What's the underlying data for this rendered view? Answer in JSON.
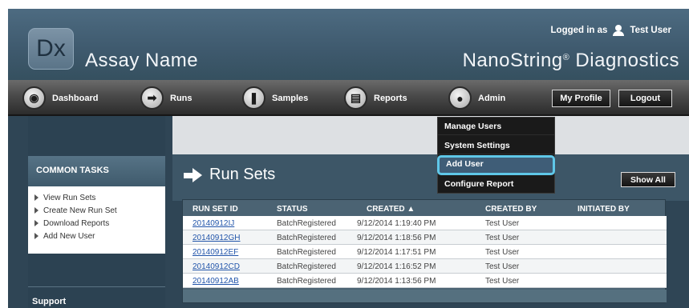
{
  "header": {
    "logo_text": "Dx",
    "app_title": "Assay Name",
    "brand_name": "NanoString",
    "brand_mark": "®",
    "brand_suffix": " Diagnostics",
    "logged_in_prefix": "Logged in as",
    "user_name": "Test User",
    "user_icon": "person-icon"
  },
  "nav": {
    "items": [
      {
        "label": "Dashboard",
        "icon": "dashboard-icon",
        "glyph": "◉"
      },
      {
        "label": "Runs",
        "icon": "runs-arrow-icon",
        "glyph": "➡"
      },
      {
        "label": "Samples",
        "icon": "samples-tube-icon",
        "glyph": "❚"
      },
      {
        "label": "Reports",
        "icon": "reports-icon",
        "glyph": "▤"
      },
      {
        "label": "Admin",
        "icon": "admin-person-icon",
        "glyph": "●"
      }
    ],
    "my_profile": "My Profile",
    "logout": "Logout"
  },
  "admin_menu": {
    "items": [
      "Manage Users",
      "System Settings",
      "Add User",
      "Configure Report"
    ],
    "highlighted": "Add User",
    "highlight_color": "#5fc7e8"
  },
  "sidebar": {
    "common_tasks_title": "COMMON TASKS",
    "tasks": [
      "View Run Sets",
      "Create New Run Set",
      "Download Reports",
      "Add New User"
    ],
    "support_title": "Support"
  },
  "run_sets": {
    "title": "Run Sets",
    "show_all": "Show All",
    "columns": [
      "RUN SET ID",
      "STATUS",
      "CREATED ▲",
      "CREATED BY",
      "INITIATED BY"
    ],
    "rows": [
      {
        "id": "20140912IJ",
        "status": "BatchRegistered",
        "created": "9/12/2014 1:19:40 PM",
        "created_by": "Test User",
        "initiated_by": ""
      },
      {
        "id": "20140912GH",
        "status": "BatchRegistered",
        "created": "9/12/2014 1:18:56 PM",
        "created_by": "Test User",
        "initiated_by": ""
      },
      {
        "id": "20140912EF",
        "status": "BatchRegistered",
        "created": "9/12/2014 1:17:51 PM",
        "created_by": "Test User",
        "initiated_by": ""
      },
      {
        "id": "20140912CD",
        "status": "BatchRegistered",
        "created": "9/12/2014 1:16:52 PM",
        "created_by": "Test User",
        "initiated_by": ""
      },
      {
        "id": "20140912AB",
        "status": "BatchRegistered",
        "created": "9/12/2014 1:13:56 PM",
        "created_by": "Test User",
        "initiated_by": ""
      }
    ]
  },
  "colors": {
    "header_bg": "#4d6b81",
    "nav_bg": "#3b3b3b",
    "panel_bg": "#2f4555",
    "link": "#2255aa"
  }
}
